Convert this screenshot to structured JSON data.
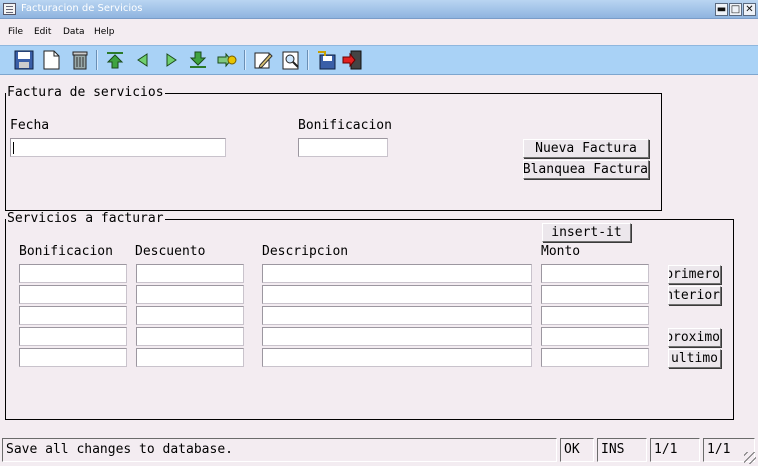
{
  "window": {
    "title": "Facturacion de Servicios",
    "minimize": "▬",
    "maximize": "□",
    "close": "✕"
  },
  "menu": [
    "File",
    "Edit",
    "Data",
    "Help"
  ],
  "toolbar": {
    "icons": [
      "save-icon",
      "new-document-icon",
      "delete-icon",
      "first-record-icon",
      "previous-record-icon",
      "next-record-icon",
      "last-record-icon",
      "find-key-icon",
      "edit-icon",
      "search-icon",
      "save-exit-icon",
      "exit-icon"
    ]
  },
  "factura": {
    "group_title": "Factura de servicios",
    "fecha_label": "Fecha",
    "fecha_value": "",
    "bonificacion_label": "Bonificacion",
    "bonificacion_value": "",
    "nueva_factura": "Nueva Factura",
    "blanquea_factura": "Blanquea Factura"
  },
  "servicios": {
    "group_title": "Servicios a facturar",
    "insert_button": "insert-it",
    "columns": {
      "bonificacion": "Bonificacion",
      "descuento": "Descuento",
      "descripcion": "Descripcion",
      "monto": "Monto"
    },
    "rows": [
      {
        "bonificacion": "",
        "descuento": "",
        "descripcion": "",
        "monto": ""
      },
      {
        "bonificacion": "",
        "descuento": "",
        "descripcion": "",
        "monto": ""
      },
      {
        "bonificacion": "",
        "descuento": "",
        "descripcion": "",
        "monto": ""
      },
      {
        "bonificacion": "",
        "descuento": "",
        "descripcion": "",
        "monto": ""
      },
      {
        "bonificacion": "",
        "descuento": "",
        "descripcion": "",
        "monto": ""
      }
    ],
    "nav": {
      "primero": "primero",
      "anterior": "anterior",
      "proximo": "proximo",
      "ultimo": "ultimo"
    }
  },
  "status": {
    "message": "Save all changes to database.",
    "ok": "OK",
    "mode": "INS",
    "record": "1/1",
    "page": "1/1"
  },
  "colors": {
    "background": "#f3ecf1",
    "toolbar": "#a9d2f6",
    "titlebar": "#8fb4df"
  }
}
